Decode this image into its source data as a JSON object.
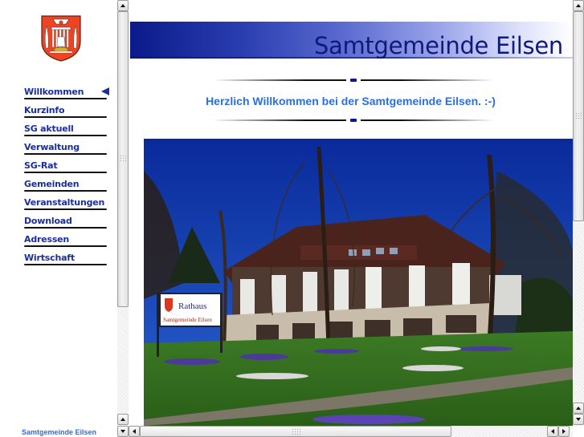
{
  "left": {
    "logo": {
      "icon": "coat-of-arms-icon",
      "alt": "Wappen Samtgemeinde Eilsen"
    },
    "nav": [
      {
        "label": "Willkommen",
        "active": true
      },
      {
        "label": "Kurzinfo",
        "active": false
      },
      {
        "label": "SG aktuell",
        "active": false
      },
      {
        "label": "Verwaltung",
        "active": false
      },
      {
        "label": "SG-Rat",
        "active": false
      },
      {
        "label": "Gemeinden",
        "active": false
      },
      {
        "label": "Veranstaltungen",
        "active": false
      },
      {
        "label": "Download",
        "active": false
      },
      {
        "label": "Adressen",
        "active": false
      },
      {
        "label": "Wirtschaft",
        "active": false
      }
    ],
    "footer": "Samtgemeinde Eilsen"
  },
  "main": {
    "banner_title": "Samtgemeinde Eilsen",
    "welcome": "Herzlich Willkommen bei der Samtgemeinde Eilsen. :-)",
    "photo": {
      "subject": "Rathaus building photo",
      "sign_title": "Rathaus",
      "sign_subtitle": "Samtgemeinde Eilsen"
    }
  },
  "colors": {
    "nav_text": "#1a2e9e",
    "welcome_text": "#2a6ee8",
    "banner_dark": "#0a1a8a",
    "title_text": "#0f1a7a",
    "footer_text": "#2f6ed6"
  }
}
